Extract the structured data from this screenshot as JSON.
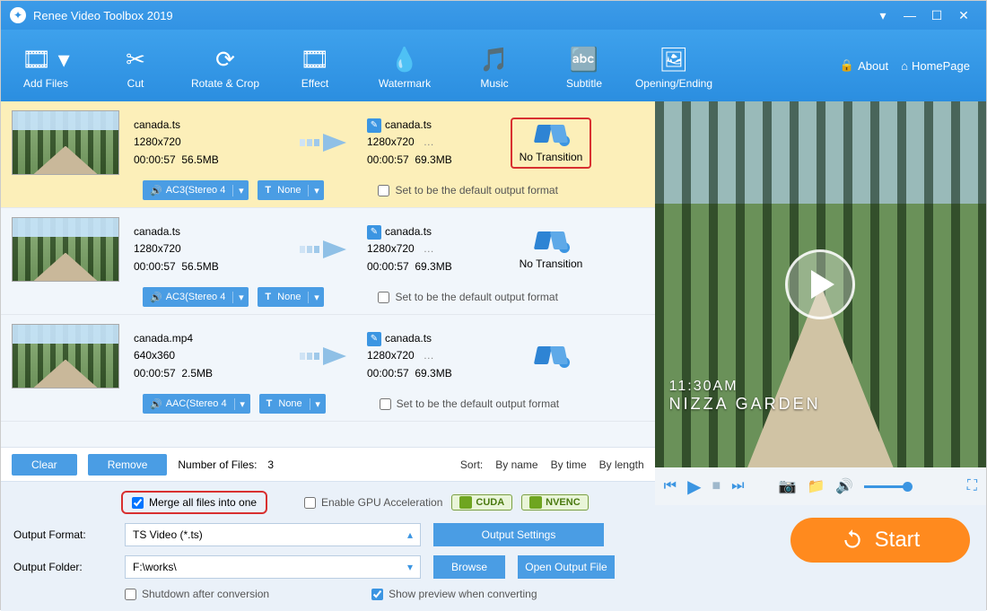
{
  "app_title": "Renee Video Toolbox 2019",
  "toolbar": [
    "Add Files",
    "Cut",
    "Rotate & Crop",
    "Effect",
    "Watermark",
    "Music",
    "Subtitle",
    "Opening/Ending"
  ],
  "links": {
    "about": "About",
    "home": "HomePage"
  },
  "files": [
    {
      "src_name": "canada.ts",
      "src_res": "1280x720",
      "src_dur": "00:00:57",
      "src_size": "56.5MB",
      "audio": "AC3(Stereo 4",
      "sub": "None",
      "out_name": "canada.ts",
      "out_res": "1280x720",
      "out_more": "…",
      "out_dur": "00:00:57",
      "out_size": "69.3MB",
      "trans": "No Transition",
      "trans_highlight": true,
      "active": true,
      "default_label": "Set to be the default output format"
    },
    {
      "src_name": "canada.ts",
      "src_res": "1280x720",
      "src_dur": "00:00:57",
      "src_size": "56.5MB",
      "audio": "AC3(Stereo 4",
      "sub": "None",
      "out_name": "canada.ts",
      "out_res": "1280x720",
      "out_more": "…",
      "out_dur": "00:00:57",
      "out_size": "69.3MB",
      "trans": "No Transition",
      "trans_highlight": false,
      "active": false,
      "default_label": "Set to be the default output format"
    },
    {
      "src_name": "canada.mp4",
      "src_res": "640x360",
      "src_dur": "00:00:57",
      "src_size": "2.5MB",
      "audio": "AAC(Stereo 4",
      "sub": "None",
      "out_name": "canada.ts",
      "out_res": "1280x720",
      "out_more": "…",
      "out_dur": "00:00:57",
      "out_size": "69.3MB",
      "trans": "",
      "trans_highlight": false,
      "active": false,
      "default_label": "Set to be the default output format"
    }
  ],
  "footer": {
    "clear": "Clear",
    "remove": "Remove",
    "count_label": "Number of Files:",
    "count": "3",
    "sort_label": "Sort:",
    "sort_options": [
      "By name",
      "By time",
      "By length"
    ]
  },
  "options": {
    "merge": "Merge all files into one",
    "gpu": "Enable GPU Acceleration",
    "badges": [
      "CUDA",
      "NVENC"
    ],
    "format_label": "Output Format:",
    "format_value": "TS Video (*.ts)",
    "output_settings": "Output Settings",
    "folder_label": "Output Folder:",
    "folder_value": "F:\\works\\",
    "browse": "Browse",
    "open_folder": "Open Output File",
    "shutdown": "Shutdown after conversion",
    "show_preview": "Show preview when converting"
  },
  "preview_overlay": {
    "line1": "11:30AM",
    "line2": "NIZZA GARDEN"
  },
  "start": "Start"
}
